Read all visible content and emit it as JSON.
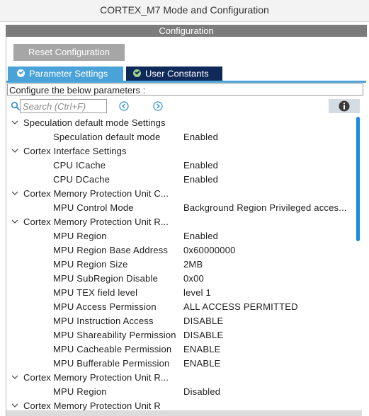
{
  "window": {
    "title": "CORTEX_M7 Mode and Configuration"
  },
  "config_header": "Configuration",
  "reset_button": "Reset Configuration",
  "tabs": [
    {
      "label": "Parameter Settings",
      "active": true
    },
    {
      "label": "User Constants",
      "active": false
    }
  ],
  "configure_text": "Configure the below parameters :",
  "search": {
    "placeholder": "Search (Ctrl+F)"
  },
  "icons": {
    "search": "search-icon",
    "prev": "arrow-left-circle-icon",
    "next": "arrow-right-circle-icon",
    "info": "info-icon",
    "chevron": "chevron-down-icon"
  },
  "colors": {
    "accent": "#4aa3d8",
    "tab_inactive": "#0f2a5a",
    "header_bg": "#7c7c7c",
    "scrollbar": "#1a8be0"
  },
  "groups": [
    {
      "label": "Speculation default mode Settings",
      "params": [
        {
          "name": "Speculation default mode",
          "value": "Enabled"
        }
      ]
    },
    {
      "label": "Cortex Interface Settings",
      "params": [
        {
          "name": "CPU ICache",
          "value": "Enabled"
        },
        {
          "name": "CPU DCache",
          "value": "Enabled"
        }
      ]
    },
    {
      "label": "Cortex Memory Protection Unit C...",
      "params": [
        {
          "name": "MPU Control Mode",
          "value": "Background Region Privileged acces..."
        }
      ]
    },
    {
      "label": "Cortex Memory Protection Unit R...",
      "params": [
        {
          "name": "MPU Region",
          "value": "Enabled"
        },
        {
          "name": "MPU Region Base Address",
          "value": "0x60000000"
        },
        {
          "name": "MPU Region Size",
          "value": "2MB"
        },
        {
          "name": "MPU SubRegion Disable",
          "value": "0x00"
        },
        {
          "name": "MPU TEX field level",
          "value": "level 1"
        },
        {
          "name": "MPU Access Permission",
          "value": "ALL ACCESS PERMITTED"
        },
        {
          "name": "MPU Instruction Access",
          "value": "DISABLE"
        },
        {
          "name": "MPU Shareability Permission",
          "value": "DISABLE"
        },
        {
          "name": "MPU Cacheable Permission",
          "value": "ENABLE"
        },
        {
          "name": "MPU Bufferable  Permission",
          "value": "ENABLE"
        }
      ]
    },
    {
      "label": "Cortex Memory Protection Unit R...",
      "params": [
        {
          "name": "MPU Region",
          "value": "Disabled"
        }
      ]
    },
    {
      "label": "Cortex Memory Protection Unit R",
      "params": []
    }
  ]
}
